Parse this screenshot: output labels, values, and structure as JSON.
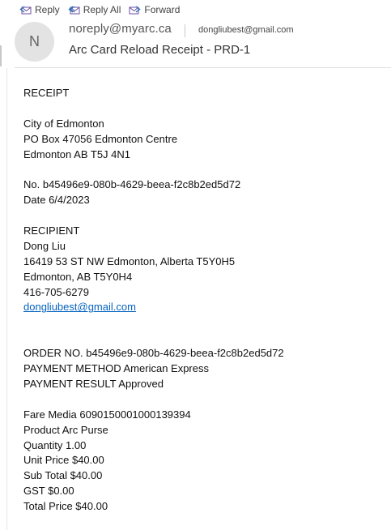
{
  "toolbar": {
    "reply_label": "Reply",
    "reply_icon": "reply-icon",
    "reply_all_label": "Reply All",
    "reply_all_icon": "reply-all-icon",
    "forward_label": "Forward",
    "forward_icon": "forward-icon"
  },
  "header": {
    "avatar_initial": "N",
    "from": "noreply@myarc.ca",
    "to": "dongliubest@gmail.com",
    "subject": "Arc Card Reload Receipt - PRD-1"
  },
  "receipt": {
    "heading": "RECEIPT",
    "issuer": {
      "name": "City of Edmonton",
      "address1": "PO Box 47056 Edmonton Centre",
      "address2": "Edmonton AB T5J 4N1"
    },
    "number": "No. b45496e9-080b-4629-beea-f2c8b2ed5d72",
    "date": "Date 6/4/2023",
    "recipient": {
      "heading": "RECIPIENT",
      "name": "Dong Liu",
      "address1": "16419 53 ST NW Edmonton, Alberta T5Y0H5",
      "address2": "Edmonton, AB T5Y0H4",
      "phone": "416-705-6279",
      "email": "dongliubest@gmail.com"
    },
    "order": {
      "order_no": "ORDER NO. b45496e9-080b-4629-beea-f2c8b2ed5d72",
      "payment_method": "PAYMENT METHOD American Express",
      "payment_result": "PAYMENT RESULT Approved"
    },
    "items": {
      "fare_media": "Fare Media 6090150001000139394",
      "product": "Product Arc Purse",
      "quantity": "Quantity 1.00",
      "unit_price": "Unit Price $40.00",
      "sub_total": "Sub Total $40.00",
      "gst": "GST $0.00",
      "total_price": "Total Price $40.00"
    }
  },
  "colors": {
    "link": "#0563c1",
    "icon_blue": "#2e6fb5",
    "icon_purple": "#6b4fa0",
    "avatar_bg": "#e3e3e3"
  }
}
